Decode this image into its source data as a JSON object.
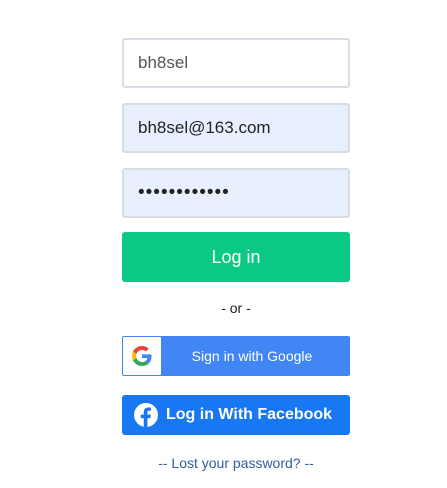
{
  "form": {
    "username_value": "bh8sel",
    "email_value": "bh8sel@163.com",
    "password_value": "••••••••••••",
    "login_label": "Log in",
    "or_text": "- or -",
    "google_label": "Sign in with Google",
    "facebook_label": "Log in With Facebook",
    "lost_password_label": "-- Lost your password? --"
  },
  "icons": {
    "google": "google-g-icon",
    "facebook": "facebook-f-icon"
  },
  "colors": {
    "login_button": "#0bc884",
    "google_button": "#4285f4",
    "facebook_button": "#1877f2",
    "autofill_background": "#e8f0fe",
    "link": "#2e5fa3"
  }
}
